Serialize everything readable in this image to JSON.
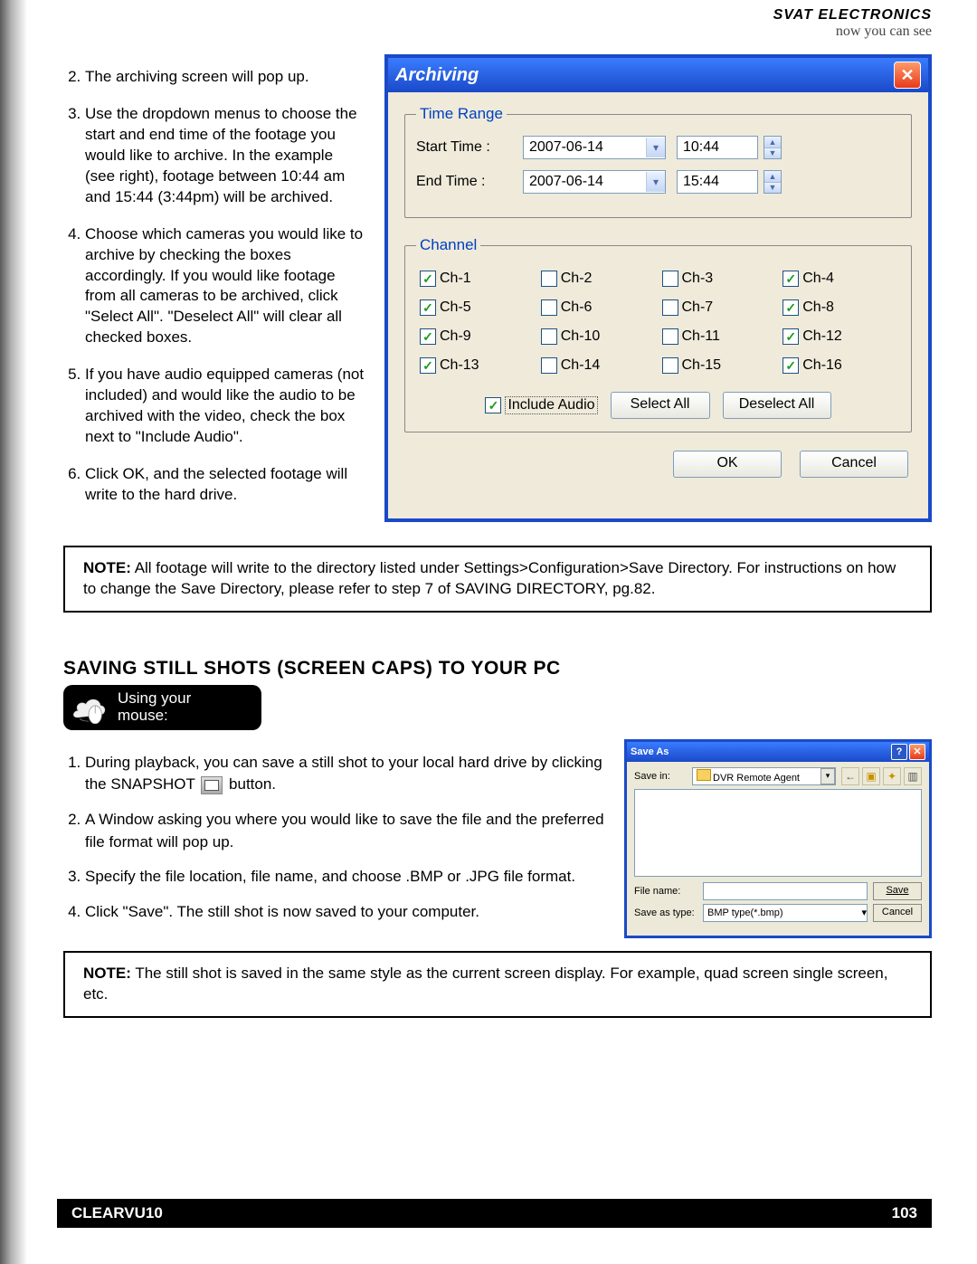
{
  "header": {
    "brand1": "SVAT ELECTRONICS",
    "brand2": "now you can see"
  },
  "instructions1": {
    "start": 2,
    "items": [
      "The archiving screen will pop up.",
      "Use the dropdown menus to choose the start and end time of the footage you would like to archive.  In the example (see right), footage between 10:44 am and 15:44 (3:44pm) will be archived.",
      "Choose which cameras you would like to archive by checking the boxes accordingly.  If you would like footage from all cameras to be archived, click \"Select All\".  \"Deselect All\" will clear all checked boxes.",
      "If you have audio equipped cameras (not included) and would like the audio to be archived with the video, check the box next to \"Include Audio\".",
      "Click OK, and the selected footage will write to the hard drive."
    ]
  },
  "archiving": {
    "title": "Archiving",
    "time_range_label": "Time Range",
    "start_label": "Start Time :",
    "end_label": "End Time :",
    "start_date": "2007-06-14",
    "start_time": "10:44",
    "end_date": "2007-06-14",
    "end_time": "15:44",
    "channel_label": "Channel",
    "channels": [
      {
        "label": "Ch-1",
        "checked": true
      },
      {
        "label": "Ch-2",
        "checked": false
      },
      {
        "label": "Ch-3",
        "checked": false
      },
      {
        "label": "Ch-4",
        "checked": true
      },
      {
        "label": "Ch-5",
        "checked": true
      },
      {
        "label": "Ch-6",
        "checked": false
      },
      {
        "label": "Ch-7",
        "checked": false
      },
      {
        "label": "Ch-8",
        "checked": true
      },
      {
        "label": "Ch-9",
        "checked": true
      },
      {
        "label": "Ch-10",
        "checked": false
      },
      {
        "label": "Ch-11",
        "checked": false
      },
      {
        "label": "Ch-12",
        "checked": true
      },
      {
        "label": "Ch-13",
        "checked": true
      },
      {
        "label": "Ch-14",
        "checked": false
      },
      {
        "label": "Ch-15",
        "checked": false
      },
      {
        "label": "Ch-16",
        "checked": true
      }
    ],
    "include_audio_label": "Include Audio",
    "include_audio_checked": true,
    "select_all": "Select All",
    "deselect_all": "Deselect All",
    "ok": "OK",
    "cancel": "Cancel"
  },
  "note1": {
    "label": "NOTE:",
    "text": "All footage will write to the directory listed under Settings>Configuration>Save Directory.  For instructions on how to change the Save Directory, please refer to step 7 of SAVING DIRECTORY, pg.82."
  },
  "section2": {
    "heading": "SAVING STILL SHOTS (SCREEN CAPS) TO YOUR PC",
    "badge_line1": "Using your",
    "badge_line2": "mouse:",
    "items_pre": "During playback, you can save a still shot to your local hard drive by clicking the SNAPSHOT",
    "items_post": "button.",
    "item2": "A Window asking you where you would like to save the file and the preferred file format will pop up.",
    "item3": "Specify the file location, file name, and choose .BMP or .JPG file format.",
    "item4": "Click \"Save\".  The still shot is now saved to your computer."
  },
  "saveas": {
    "title": "Save As",
    "save_in_label": "Save in:",
    "save_in_value": "DVR Remote Agent",
    "file_name_label": "File name:",
    "file_name_value": "",
    "save_as_type_label": "Save as type:",
    "save_as_type_value": "BMP type(*.bmp)",
    "save": "Save",
    "cancel": "Cancel"
  },
  "note2": {
    "label": "NOTE:",
    "text": "The still shot is saved in the same style as the current screen display.  For example, quad screen single screen, etc."
  },
  "footer": {
    "product": "CLEARVU10",
    "page": "103"
  }
}
